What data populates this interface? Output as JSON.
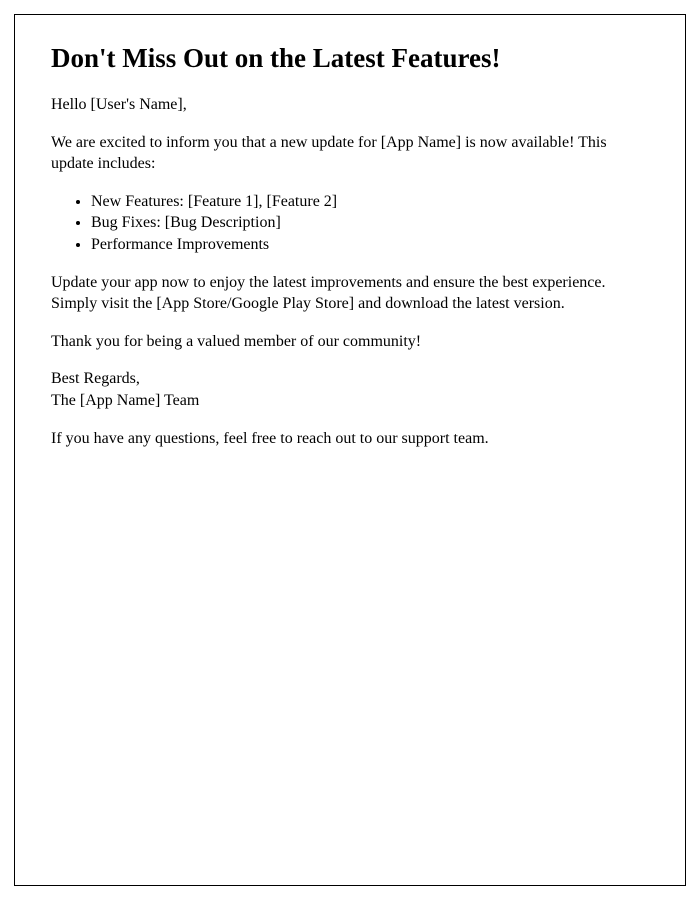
{
  "title": "Don't Miss Out on the Latest Features!",
  "greeting": "Hello [User's Name],",
  "intro": "We are excited to inform you that a new update for [App Name] is now available! This update includes:",
  "bullets": [
    "New Features: [Feature 1], [Feature 2]",
    "Bug Fixes: [Bug Description]",
    "Performance Improvements"
  ],
  "update_instructions": "Update your app now to enjoy the latest improvements and ensure the best experience. Simply visit the [App Store/Google Play Store] and download the latest version.",
  "thanks": "Thank you for being a valued member of our community!",
  "signoff": {
    "regards": "Best Regards,",
    "team": "The [App Name] Team"
  },
  "support": "If you have any questions, feel free to reach out to our support team."
}
